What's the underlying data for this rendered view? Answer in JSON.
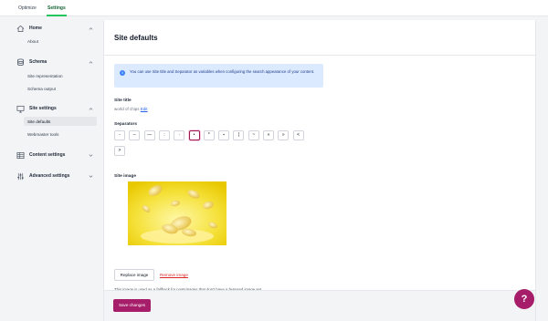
{
  "topbar": {
    "tabs": [
      {
        "label": "Optimize"
      },
      {
        "label": "Settings"
      }
    ]
  },
  "sidebar": {
    "home": {
      "label": "Home",
      "items": [
        {
          "label": "About"
        }
      ]
    },
    "schema": {
      "label": "Schema",
      "items": [
        {
          "label": "Site representation"
        },
        {
          "label": "Schema output"
        }
      ]
    },
    "site_settings": {
      "label": "Site settings",
      "items": [
        {
          "label": "Site defaults"
        },
        {
          "label": "Webmaster tools"
        }
      ]
    },
    "content_settings": {
      "label": "Content settings"
    },
    "advanced_settings": {
      "label": "Advanced settings"
    }
  },
  "main": {
    "title": "Site defaults",
    "info_text": "You can use Site title and Separator as variables when configuring the search appearance of your content.",
    "site_title_label": "Site title",
    "site_title_value": "world of chips",
    "edit_label": "Edit",
    "separators_label": "Separators",
    "separators": [
      "-",
      "–",
      "—",
      ":",
      "·",
      "•",
      "*",
      "⋆",
      "|",
      "~",
      "«",
      "»",
      "<",
      ">"
    ],
    "selected_separator_index": 5,
    "site_image_label": "Site image",
    "replace_image_label": "Replace image",
    "remove_image_label": "Remove image",
    "image_note": "This image is used as a fallback for posts/pages that don't have a featured image set.",
    "save_label": "Save changes"
  },
  "help": {
    "label": "?"
  },
  "colors": {
    "accent": "#a61e69",
    "active_green": "#22c55e",
    "info_bg": "#dbeafe"
  }
}
